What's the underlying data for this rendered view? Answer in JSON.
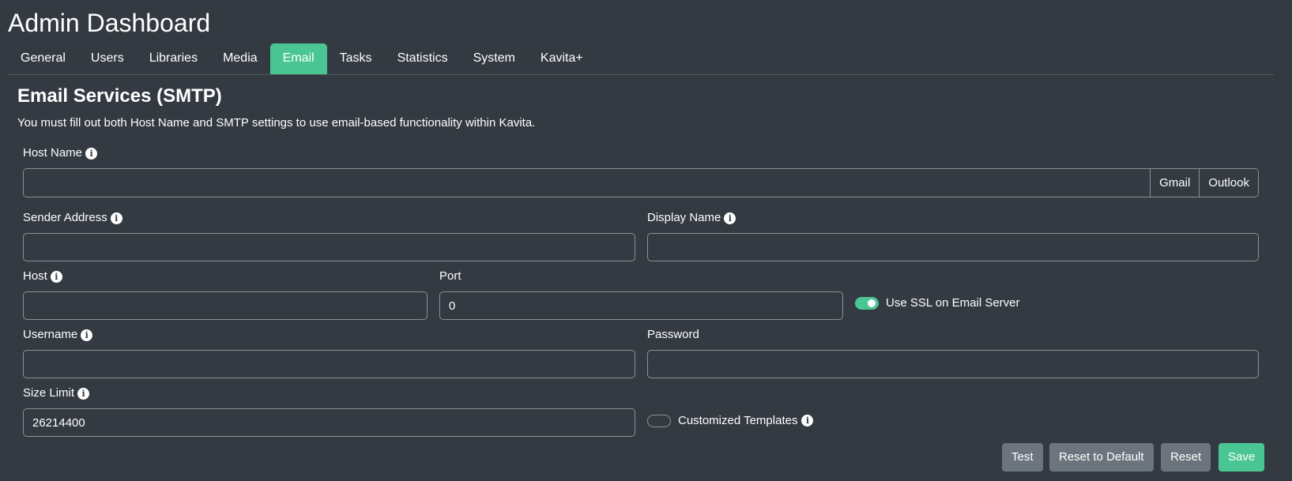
{
  "page": {
    "title": "Admin Dashboard"
  },
  "tabs": [
    {
      "label": "General"
    },
    {
      "label": "Users"
    },
    {
      "label": "Libraries"
    },
    {
      "label": "Media"
    },
    {
      "label": "Email",
      "active": true
    },
    {
      "label": "Tasks"
    },
    {
      "label": "Statistics"
    },
    {
      "label": "System"
    },
    {
      "label": "Kavita+"
    }
  ],
  "section": {
    "title": "Email Services (SMTP)",
    "description": "You must fill out both Host Name and SMTP settings to use email-based functionality within Kavita."
  },
  "fields": {
    "host_name": {
      "label": "Host Name",
      "value": "",
      "preset_gmail": "Gmail",
      "preset_outlook": "Outlook"
    },
    "sender_address": {
      "label": "Sender Address",
      "value": ""
    },
    "display_name": {
      "label": "Display Name",
      "value": ""
    },
    "host": {
      "label": "Host",
      "value": ""
    },
    "port": {
      "label": "Port",
      "value": "0"
    },
    "use_ssl": {
      "label": "Use SSL on Email Server",
      "checked": true
    },
    "username": {
      "label": "Username",
      "value": ""
    },
    "password": {
      "label": "Password",
      "value": ""
    },
    "size_limit": {
      "label": "Size Limit",
      "value": "26214400"
    },
    "customized_templates": {
      "label": "Customized Templates",
      "checked": false
    }
  },
  "buttons": {
    "test": "Test",
    "reset_default": "Reset to Default",
    "reset": "Reset",
    "save": "Save"
  },
  "icons": {
    "info": "info-icon"
  },
  "colors": {
    "background": "#343a42",
    "accent": "#4ac694",
    "secondary_button": "#6c757d"
  }
}
